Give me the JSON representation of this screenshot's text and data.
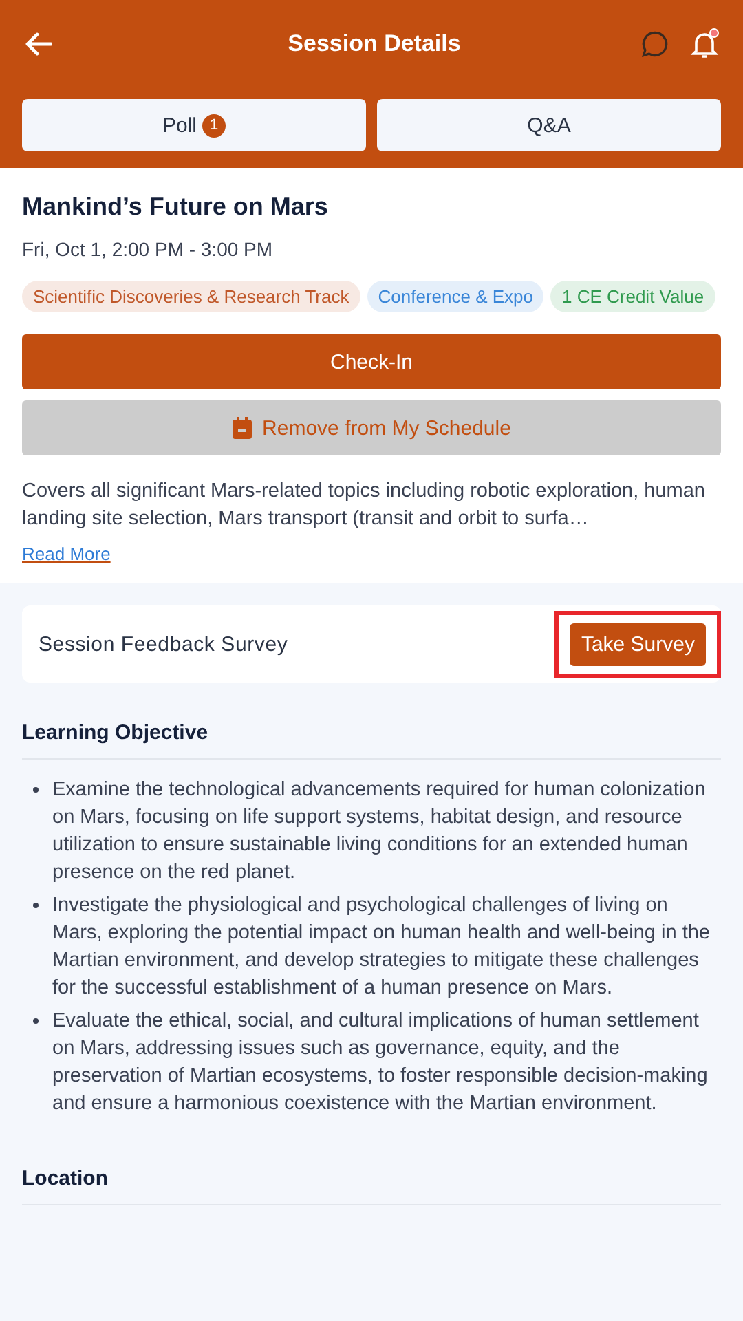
{
  "header": {
    "title": "Session Details",
    "notification_dot": true
  },
  "tabs": [
    {
      "label": "Poll",
      "badge": "1"
    },
    {
      "label": "Q&A"
    }
  ],
  "session": {
    "title": "Mankind’s Future on Mars",
    "time": "Fri, Oct 1, 2:00 PM - 3:00 PM",
    "tags": [
      {
        "label": "Scientific Discoveries & Research Track",
        "color": "#c0582a"
      },
      {
        "label": "Conference & Expo",
        "color": "#3a86d8"
      },
      {
        "label": "1 CE Credit Value",
        "color": "#2f9a4e"
      }
    ],
    "check_in": "Check-In",
    "remove": "Remove from My Schedule",
    "description": "Covers all significant Mars-related topics including robotic exploration, human landing site selection, Mars transport (transit and orbit to surfa…",
    "read_more": "Read More"
  },
  "survey": {
    "label": "Session Feedback Survey",
    "button": "Take Survey",
    "highlighted": true
  },
  "learning": {
    "heading": "Learning Objective",
    "items": [
      "Examine the technological advancements required for human colonization on Mars, focusing on life support systems, habitat design, and resource utilization to ensure sustainable living conditions for an extended human presence on the red planet.",
      "Investigate the physiological and psychological challenges of living on Mars, exploring the potential impact on human health and well-being in the Martian environment, and develop strategies to mitigate these challenges for the successful establishment of a human presence on Mars.",
      "Evaluate the ethical, social, and cultural implications of human settlement on Mars, addressing issues such as governance, equity, and the preservation of Martian ecosystems, to foster responsible decision-making and ensure a harmonious coexistence with the Martian environment."
    ]
  },
  "location": {
    "heading": "Location"
  }
}
